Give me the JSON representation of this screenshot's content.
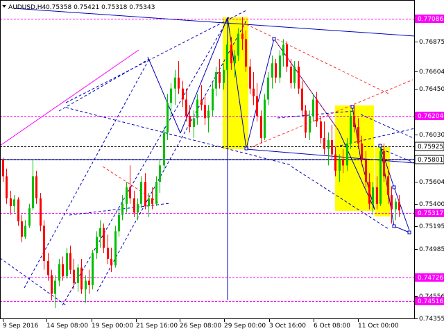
{
  "header": {
    "symbol_label": "AUDUSD,H4",
    "ohlc_label": "0.75358 0.75421 0.75318 0.75343"
  },
  "colors": {
    "bull": "#00c000",
    "bear": "#ff0000",
    "magenta": "#ff00ff",
    "blue": "#0000bb",
    "black": "#000000",
    "highlight": "#ffff00",
    "price_tag_magenta": "#ff00ff",
    "price_tag_white": "#ffffff"
  },
  "chart_data": {
    "type": "candlestick",
    "title": "AUDUSD,H4",
    "x_tick_labels": [
      "9 Sep 2016",
      "14 Sep 08:00",
      "19 Sep 00:00",
      "21 Sep 16:00",
      "26 Sep 08:00",
      "29 Sep 00:00",
      "3 Oct 16:00",
      "6 Oct 08:00",
      "11 Oct 00:00"
    ],
    "y_tick_labels": [
      "0.77086",
      "0.76875",
      "0.76604",
      "0.76450",
      "0.76204",
      "0.76030",
      "0.75925",
      "0.75801",
      "0.75604",
      "0.75400",
      "0.75317",
      "0.75195",
      "0.74985",
      "0.74726",
      "0.74556",
      "0.74516",
      "0.74355"
    ],
    "ylim": [
      0.7435,
      0.7725
    ],
    "horizontal_levels": [
      {
        "label": "0.77086",
        "value": 0.77086,
        "style": "magenta-dashed",
        "tag": "magenta"
      },
      {
        "label": "0.76204",
        "value": 0.76204,
        "style": "magenta-dashed",
        "tag": "magenta"
      },
      {
        "label": "0.75925",
        "value": 0.75925,
        "style": "black-dashed",
        "tag": "white"
      },
      {
        "label": "0.75801",
        "value": 0.75801,
        "style": "black-dashed",
        "tag": "white"
      },
      {
        "label": "0.75317",
        "value": 0.75317,
        "style": "magenta-dashed",
        "tag": "magenta"
      },
      {
        "label": "0.74726",
        "value": 0.74726,
        "style": "magenta-dashed",
        "tag": "magenta"
      },
      {
        "label": "0.74516",
        "value": 0.74516,
        "style": "magenta-dashed",
        "tag": "magenta"
      }
    ],
    "candles_ohlc": [
      [
        0.758,
        0.7582,
        0.756,
        0.7565
      ],
      [
        0.7565,
        0.7572,
        0.754,
        0.7545
      ],
      [
        0.7545,
        0.7552,
        0.753,
        0.7538
      ],
      [
        0.7538,
        0.7548,
        0.7532,
        0.7544
      ],
      [
        0.7544,
        0.7546,
        0.752,
        0.7524
      ],
      [
        0.7524,
        0.753,
        0.7505,
        0.751
      ],
      [
        0.751,
        0.7525,
        0.7508,
        0.752
      ],
      [
        0.752,
        0.754,
        0.7518,
        0.7536
      ],
      [
        0.7536,
        0.758,
        0.7534,
        0.7565
      ],
      [
        0.7565,
        0.757,
        0.754,
        0.7545
      ],
      [
        0.7545,
        0.755,
        0.7515,
        0.752
      ],
      [
        0.752,
        0.7525,
        0.748,
        0.7488
      ],
      [
        0.7488,
        0.7495,
        0.747,
        0.7475
      ],
      [
        0.7475,
        0.748,
        0.7452,
        0.7458
      ],
      [
        0.7458,
        0.7475,
        0.7445,
        0.747
      ],
      [
        0.747,
        0.749,
        0.7465,
        0.7485
      ],
      [
        0.7485,
        0.7492,
        0.747,
        0.7474
      ],
      [
        0.7474,
        0.75,
        0.7472,
        0.7495
      ],
      [
        0.7495,
        0.7502,
        0.7476,
        0.748
      ],
      [
        0.748,
        0.749,
        0.7462,
        0.7468
      ],
      [
        0.7468,
        0.7485,
        0.746,
        0.7482
      ],
      [
        0.7482,
        0.749,
        0.7458,
        0.7462
      ],
      [
        0.7462,
        0.7475,
        0.745,
        0.747
      ],
      [
        0.747,
        0.748,
        0.7458,
        0.7466
      ],
      [
        0.7466,
        0.7498,
        0.7462,
        0.7495
      ],
      [
        0.7495,
        0.7515,
        0.749,
        0.751
      ],
      [
        0.751,
        0.7525,
        0.75,
        0.7518
      ],
      [
        0.7518,
        0.7522,
        0.7495,
        0.75
      ],
      [
        0.75,
        0.7512,
        0.7485,
        0.749
      ],
      [
        0.749,
        0.75,
        0.7478,
        0.7484
      ],
      [
        0.7484,
        0.752,
        0.7482,
        0.7515
      ],
      [
        0.7515,
        0.7535,
        0.751,
        0.753
      ],
      [
        0.753,
        0.7548,
        0.7525,
        0.754
      ],
      [
        0.754,
        0.756,
        0.7532,
        0.7555
      ],
      [
        0.7555,
        0.7575,
        0.754,
        0.7545
      ],
      [
        0.7545,
        0.7552,
        0.7528,
        0.7532
      ],
      [
        0.7532,
        0.7545,
        0.7525,
        0.754
      ],
      [
        0.754,
        0.7565,
        0.7536,
        0.756
      ],
      [
        0.756,
        0.7568,
        0.7535,
        0.7538
      ],
      [
        0.7538,
        0.755,
        0.7528,
        0.7545
      ],
      [
        0.7545,
        0.7555,
        0.7535,
        0.754
      ],
      [
        0.754,
        0.7565,
        0.7538,
        0.756
      ],
      [
        0.756,
        0.758,
        0.755,
        0.7575
      ],
      [
        0.7575,
        0.761,
        0.757,
        0.7605
      ],
      [
        0.7605,
        0.764,
        0.7598,
        0.7632
      ],
      [
        0.7632,
        0.765,
        0.762,
        0.7645
      ],
      [
        0.7645,
        0.7662,
        0.763,
        0.7655
      ],
      [
        0.7655,
        0.767,
        0.764,
        0.7645
      ],
      [
        0.7645,
        0.7652,
        0.7628,
        0.7635
      ],
      [
        0.7635,
        0.7645,
        0.7615,
        0.762
      ],
      [
        0.762,
        0.763,
        0.7605,
        0.761
      ],
      [
        0.761,
        0.7625,
        0.76,
        0.7618
      ],
      [
        0.7618,
        0.764,
        0.7612,
        0.7635
      ],
      [
        0.7635,
        0.7648,
        0.7625,
        0.763
      ],
      [
        0.763,
        0.7638,
        0.7612,
        0.7618
      ],
      [
        0.7618,
        0.763,
        0.7605,
        0.7625
      ],
      [
        0.7625,
        0.765,
        0.762,
        0.7645
      ],
      [
        0.7645,
        0.7665,
        0.7638,
        0.766
      ],
      [
        0.766,
        0.7672,
        0.7645,
        0.765
      ],
      [
        0.765,
        0.7668,
        0.7644,
        0.7662
      ],
      [
        0.7662,
        0.769,
        0.7658,
        0.7685
      ],
      [
        0.7685,
        0.7692,
        0.7662,
        0.7668
      ],
      [
        0.7668,
        0.768,
        0.7655,
        0.7675
      ],
      [
        0.7675,
        0.77,
        0.767,
        0.7695
      ],
      [
        0.7695,
        0.771,
        0.768,
        0.769
      ],
      [
        0.769,
        0.7698,
        0.766,
        0.7665
      ],
      [
        0.7665,
        0.7672,
        0.764,
        0.7645
      ],
      [
        0.7645,
        0.766,
        0.763,
        0.7638
      ],
      [
        0.7638,
        0.765,
        0.7615,
        0.762
      ],
      [
        0.762,
        0.7625,
        0.7595,
        0.76
      ],
      [
        0.76,
        0.764,
        0.7598,
        0.7635
      ],
      [
        0.7635,
        0.766,
        0.763,
        0.7655
      ],
      [
        0.7655,
        0.7675,
        0.7645,
        0.7668
      ],
      [
        0.7668,
        0.7672,
        0.765,
        0.7655
      ],
      [
        0.7655,
        0.768,
        0.765,
        0.7675
      ],
      [
        0.7675,
        0.769,
        0.7665,
        0.7685
      ],
      [
        0.7685,
        0.7688,
        0.766,
        0.7665
      ],
      [
        0.7665,
        0.7672,
        0.7645,
        0.765
      ],
      [
        0.765,
        0.767,
        0.7645,
        0.7665
      ],
      [
        0.7665,
        0.767,
        0.764,
        0.7645
      ],
      [
        0.7645,
        0.7652,
        0.762,
        0.7625
      ],
      [
        0.7625,
        0.763,
        0.76,
        0.7605
      ],
      [
        0.7605,
        0.7625,
        0.7598,
        0.762
      ],
      [
        0.762,
        0.764,
        0.7615,
        0.7635
      ],
      [
        0.7635,
        0.7642,
        0.761,
        0.7615
      ],
      [
        0.7615,
        0.762,
        0.7595,
        0.76
      ],
      [
        0.76,
        0.7615,
        0.7585,
        0.759
      ],
      [
        0.759,
        0.7605,
        0.7575,
        0.7598
      ],
      [
        0.7598,
        0.7612,
        0.758,
        0.7585
      ],
      [
        0.7585,
        0.7592,
        0.7565,
        0.757
      ],
      [
        0.757,
        0.7585,
        0.756,
        0.758
      ],
      [
        0.758,
        0.759,
        0.7568,
        0.7575
      ],
      [
        0.7575,
        0.76,
        0.757,
        0.7595
      ],
      [
        0.7595,
        0.7625,
        0.759,
        0.762
      ],
      [
        0.762,
        0.763,
        0.7605,
        0.761
      ],
      [
        0.761,
        0.7618,
        0.759,
        0.7595
      ],
      [
        0.7595,
        0.7602,
        0.7575,
        0.758
      ],
      [
        0.758,
        0.7588,
        0.7555,
        0.756
      ],
      [
        0.756,
        0.7568,
        0.7535,
        0.754
      ],
      [
        0.754,
        0.756,
        0.753,
        0.7555
      ],
      [
        0.7555,
        0.7565,
        0.7535,
        0.754
      ],
      [
        0.754,
        0.7592,
        0.7538,
        0.7588
      ],
      [
        0.7588,
        0.7595,
        0.756,
        0.7565
      ],
      [
        0.7565,
        0.7572,
        0.754,
        0.7548
      ],
      [
        0.7548,
        0.7556,
        0.7522,
        0.7535
      ],
      [
        0.7535,
        0.7545,
        0.7525,
        0.7542
      ],
      [
        0.7542,
        0.7548,
        0.7528,
        0.7534
      ]
    ]
  }
}
